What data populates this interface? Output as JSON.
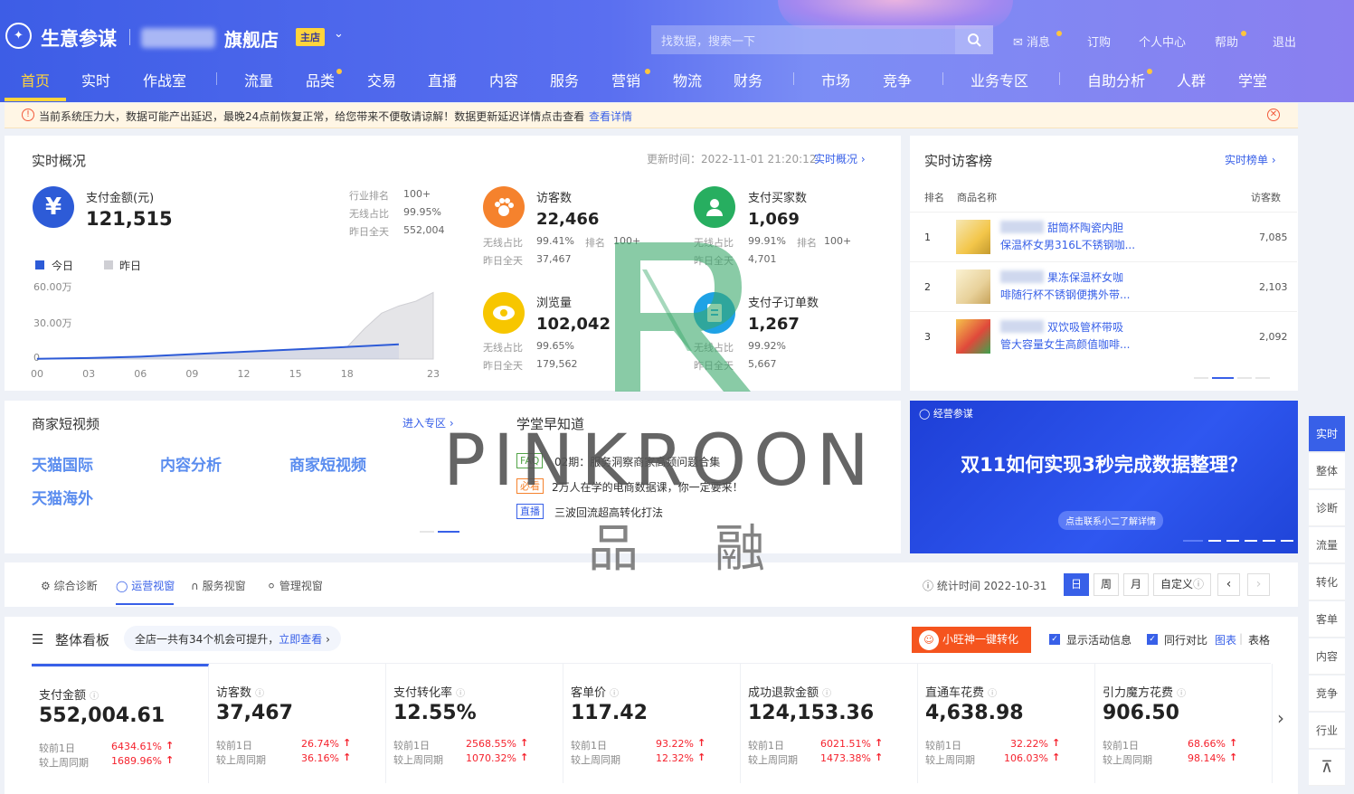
{
  "header": {
    "brand": "生意参谋",
    "shop_name": "旗舰店",
    "shop_badge": "主店",
    "search_placeholder": "找数据，搜索一下",
    "links": {
      "message": "消息",
      "subscribe": "订购",
      "personal": "个人中心",
      "help": "帮助",
      "logout": "退出"
    }
  },
  "nav": [
    "首页",
    "实时",
    "作战室",
    "流量",
    "品类",
    "交易",
    "直播",
    "内容",
    "服务",
    "营销",
    "物流",
    "财务",
    "市场",
    "竞争",
    "业务专区",
    "自助分析",
    "人群",
    "学堂"
  ],
  "notice": {
    "text": "当前系统压力大，数据可能产出延迟，最晚24点前恢复正常，给您带来不便敬请谅解！数据更新延迟详情点击查看",
    "link": "查看详情"
  },
  "realtime": {
    "title": "实时概况",
    "update_time": "更新时间：2022-11-01 21:20:12",
    "link": "实时概况",
    "pay_amount": {
      "label": "支付金额(元)",
      "value": "121,515",
      "rank_label": "行业排名",
      "rank": "100+",
      "wireless_label": "无线占比",
      "wireless": "99.95%",
      "yesterday_label": "昨日全天",
      "yesterday": "552,004"
    },
    "legend_today": "今日",
    "legend_yesterday": "昨日",
    "visitors": {
      "label": "访客数",
      "value": "22,466",
      "wireless_label": "无线占比",
      "wireless": "99.41%",
      "rank_label": "排名",
      "rank": "100+",
      "yesterday_label": "昨日全天",
      "yesterday": "37,467"
    },
    "buyers": {
      "label": "支付买家数",
      "value": "1,069",
      "wireless_label": "无线占比",
      "wireless": "99.91%",
      "rank_label": "排名",
      "rank": "100+",
      "yesterday_label": "昨日全天",
      "yesterday": "4,701"
    },
    "pageviews": {
      "label": "浏览量",
      "value": "102,042",
      "wireless_label": "无线占比",
      "wireless": "99.65%",
      "yesterday_label": "昨日全天",
      "yesterday": "179,562"
    },
    "suborders": {
      "label": "支付子订单数",
      "value": "1,267",
      "wireless_label": "无线占比",
      "wireless": "99.92%",
      "yesterday_label": "昨日全天",
      "yesterday": "5,667"
    }
  },
  "chart_data": {
    "type": "area",
    "x": [
      "00",
      "03",
      "06",
      "09",
      "12",
      "15",
      "18",
      "23"
    ],
    "yticks": [
      "60.00万",
      "30.00万",
      "0"
    ],
    "ylim": [
      0,
      600000
    ],
    "series": [
      {
        "name": "今日",
        "color": "#2d5bd7",
        "x": [
          0,
          3,
          6,
          9,
          12,
          15,
          18,
          21
        ],
        "values": [
          2000,
          8000,
          20000,
          40000,
          60000,
          80000,
          100000,
          121515
        ]
      },
      {
        "name": "昨日",
        "color": "#cfcfd4",
        "x": [
          0,
          3,
          6,
          9,
          12,
          15,
          18,
          19,
          20,
          21,
          22,
          23
        ],
        "values": [
          2000,
          8000,
          20000,
          40000,
          60000,
          80000,
          100000,
          250000,
          380000,
          440000,
          480000,
          552004
        ]
      }
    ]
  },
  "visitor_rank": {
    "title": "实时访客榜",
    "link": "实时榜单",
    "col_rank": "排名",
    "col_name": "商品名称",
    "col_visitors": "访客数",
    "rows": [
      {
        "rank": "1",
        "name1": "甜筒杯陶瓷内胆",
        "name2": "保温杯女男316L不锈钢咖...",
        "visitors": "7,085"
      },
      {
        "rank": "2",
        "name1": "果冻保温杯女咖",
        "name2": "啡随行杯不锈钢便携外带...",
        "visitors": "2,103"
      },
      {
        "rank": "3",
        "name1": "双饮吸管杯带吸",
        "name2": "管大容量女生高颜值咖啡...",
        "visitors": "2,092"
      }
    ]
  },
  "short_video": {
    "title": "商家短视频",
    "link": "进入专区",
    "items": [
      "天猫国际",
      "内容分析",
      "商家短视频",
      "天猫海外"
    ]
  },
  "school": {
    "title": "学堂早知道",
    "items": [
      {
        "tag": "FAQ",
        "text": "02期：服务洞察商家高频问题合集",
        "color": "#52a447"
      },
      {
        "tag": "必看",
        "text": "2万人在学的电商数据课，你一定要来！",
        "color": "#f5822d"
      },
      {
        "tag": "直播",
        "text": "三波回流超高转化打法",
        "color": "#3860e8"
      }
    ]
  },
  "banner": {
    "brand": "经营参谋",
    "title": "双11如何实现3秒完成数据整理？",
    "cta": "点击联系小二了解详情"
  },
  "tabs": {
    "items": [
      "综合诊断",
      "运营视窗",
      "服务视窗",
      "管理视窗"
    ],
    "active": "运营视窗",
    "stat_time": "统计时间 2022-10-31",
    "periods": [
      "日",
      "周",
      "月",
      "自定义"
    ]
  },
  "board": {
    "title": "整体看板",
    "hint": "全店一共有34个机会可提升，",
    "hint_link": "立即查看",
    "xiaowang": "小旺神一键转化",
    "show_activity": "显示活动信息",
    "peer_compare": "同行对比",
    "view_chart": "图表",
    "view_table": "表格",
    "cmp_day": "较前1日",
    "cmp_week": "较上周同期",
    "kpis": [
      {
        "name": "支付金额",
        "value": "552,004.61",
        "day": "6434.61%",
        "week": "1689.96%"
      },
      {
        "name": "访客数",
        "value": "37,467",
        "day": "26.74%",
        "week": "36.16%"
      },
      {
        "name": "支付转化率",
        "value": "12.55%",
        "day": "2568.55%",
        "week": "1070.32%"
      },
      {
        "name": "客单价",
        "value": "117.42",
        "day": "93.22%",
        "week": "12.32%"
      },
      {
        "name": "成功退款金额",
        "value": "124,153.36",
        "day": "6021.51%",
        "week": "1473.38%"
      },
      {
        "name": "直通车花费",
        "value": "4,638.98",
        "day": "32.22%",
        "week": "106.03%"
      },
      {
        "name": "引力魔方花费",
        "value": "906.50",
        "day": "68.66%",
        "week": "98.14%"
      }
    ]
  },
  "side_tabs": [
    "实时",
    "整体",
    "诊断",
    "流量",
    "转化",
    "客单",
    "内容",
    "竞争",
    "行业"
  ],
  "watermark": {
    "brand": "PINKROON",
    "cn1": "品",
    "cn2": "融"
  },
  "colors": {
    "accent": "#3860e8",
    "up": "#f5222d",
    "nav_bg": "#4a63ea",
    "nav_active": "#ffd43b"
  }
}
